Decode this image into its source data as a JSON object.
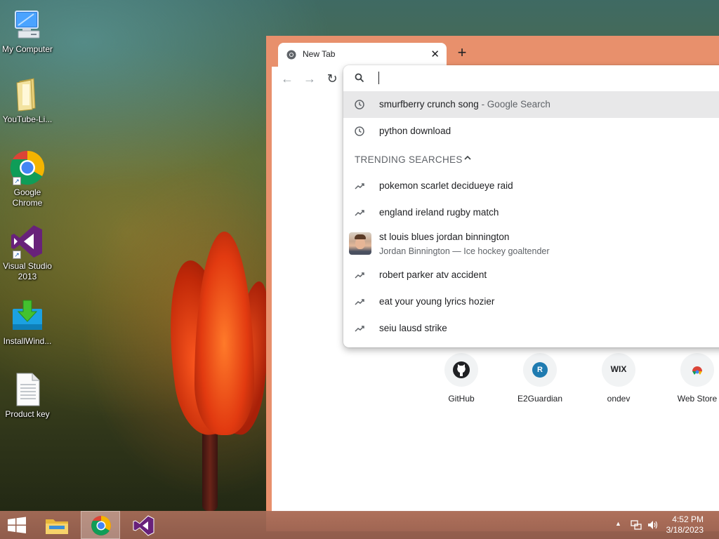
{
  "desktop": {
    "icons": [
      {
        "label": "My Computer"
      },
      {
        "label": "YouTube-Li..."
      },
      {
        "label": "Google Chrome"
      },
      {
        "label": "Visual Studio 2013"
      },
      {
        "label": "InstallWind..."
      },
      {
        "label": "Product key"
      }
    ]
  },
  "browser": {
    "tab_title": "New Tab",
    "tab_close": "✕",
    "new_tab": "+",
    "nav": {
      "back": "←",
      "forward": "→",
      "reload": "↻"
    },
    "omnibox": {
      "history": [
        {
          "query": "smurfberry crunch song",
          "suffix": " - Google Search"
        },
        {
          "query": "python download",
          "suffix": ""
        }
      ],
      "trending_header": "TRENDING SEARCHES",
      "trending": [
        {
          "query": "pokemon scarlet decidueye raid"
        },
        {
          "query": "england ireland rugby match"
        },
        {
          "query": "st louis blues jordan binnington",
          "subtitle": "Jordan Binnington — Ice hockey goaltender"
        },
        {
          "query": "robert parker atv accident"
        },
        {
          "query": "eat your young lyrics hozier"
        },
        {
          "query": "seiu lausd strike"
        }
      ]
    },
    "shortcuts": [
      {
        "label": "GitHub"
      },
      {
        "label": "E2Guardian",
        "letter": "R"
      },
      {
        "label": "ondev",
        "letter": "WIX"
      },
      {
        "label": "Web Store"
      }
    ]
  },
  "taskbar": {
    "time": "4:52 PM",
    "date": "3/18/2023",
    "tray_arrow": "▲"
  },
  "colors": {
    "window_frame": "#e8906c",
    "selected_row": "#e8e8e9",
    "e2guardian_badge": "#1f7bb0"
  }
}
